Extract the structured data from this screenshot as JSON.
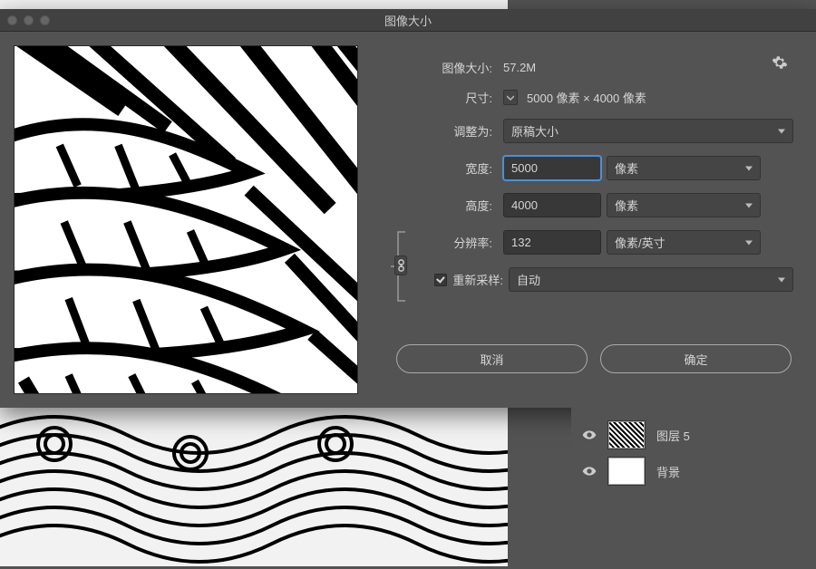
{
  "dialog": {
    "title": "图像大小",
    "image_size_label": "图像大小:",
    "image_size_value": "57.2M",
    "dimensions_label": "尺寸:",
    "dimensions_value": "5000 像素 × 4000 像素",
    "fit_to_label": "调整为:",
    "fit_to_value": "原稿大小",
    "width_label": "宽度:",
    "width_value": "5000",
    "width_unit": "像素",
    "height_label": "高度:",
    "height_value": "4000",
    "height_unit": "像素",
    "resolution_label": "分辨率:",
    "resolution_value": "132",
    "resolution_unit": "像素/英寸",
    "resample_label": "重新采样:",
    "resample_value": "自动",
    "cancel_label": "取消",
    "ok_label": "确定"
  },
  "layers": {
    "items": [
      {
        "name": "图层 5"
      },
      {
        "name": "背景"
      }
    ]
  }
}
